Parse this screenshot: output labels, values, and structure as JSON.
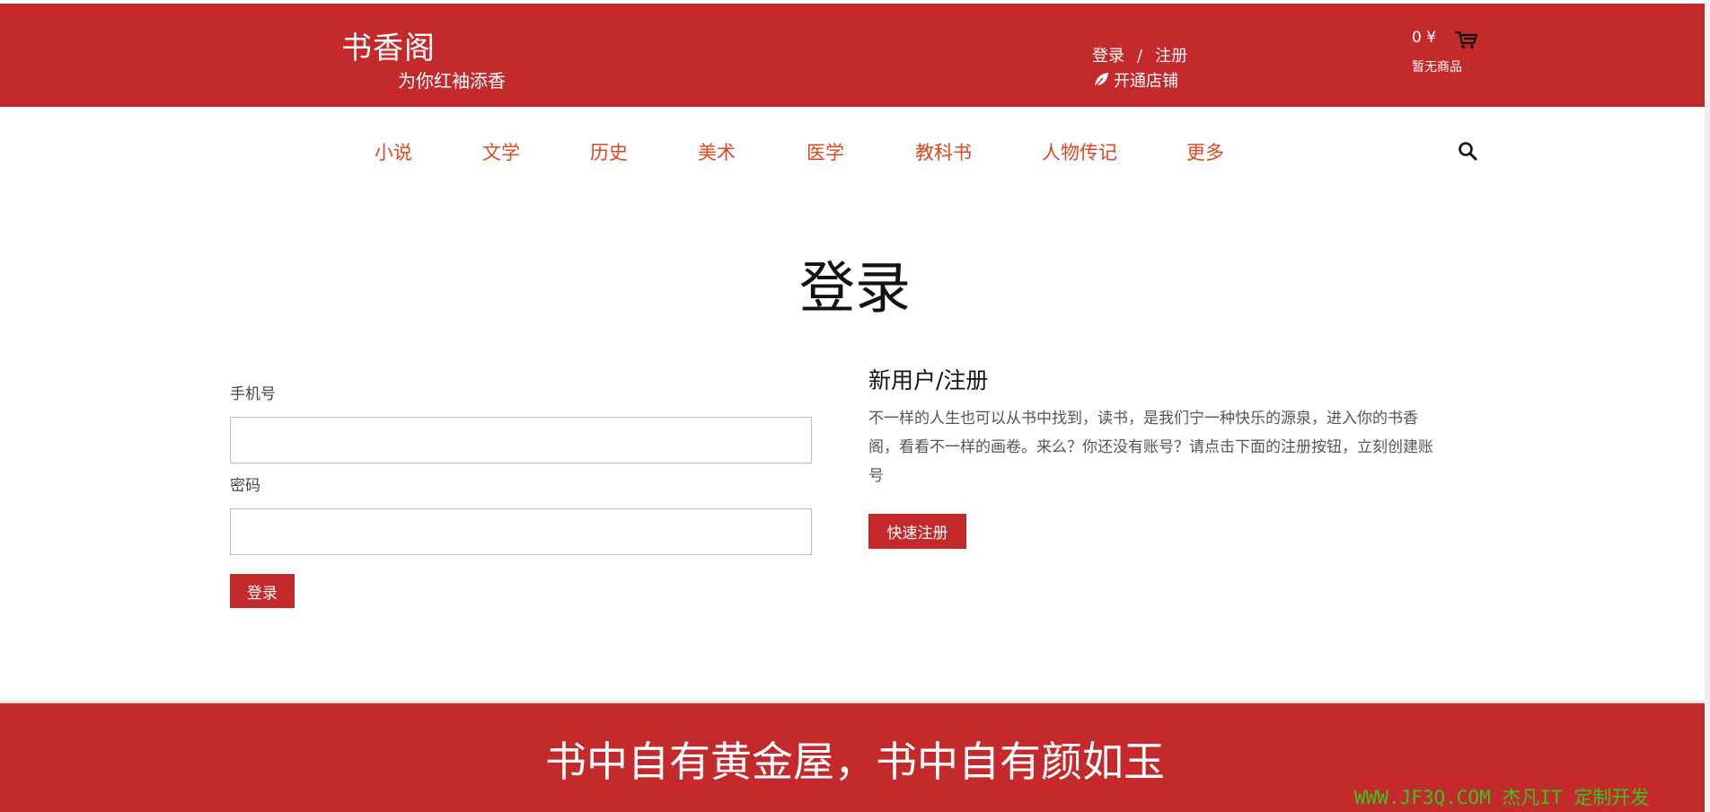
{
  "header": {
    "logo_title": "书香阁",
    "logo_subtitle": "为你红袖添香",
    "login_link": "登录",
    "separator": "/",
    "register_link": "注册",
    "open_shop_label": "开通店铺",
    "cart_amount": "0 ¥",
    "cart_status": "暂无商品"
  },
  "nav": {
    "items": [
      {
        "label": "小说"
      },
      {
        "label": "文学"
      },
      {
        "label": "历史"
      },
      {
        "label": "美术"
      },
      {
        "label": "医学"
      },
      {
        "label": "教科书"
      },
      {
        "label": "人物传记"
      },
      {
        "label": "更多"
      }
    ]
  },
  "main": {
    "title": "登录",
    "login_form": {
      "phone_label": "手机号",
      "phone_value": "",
      "password_label": "密码",
      "password_value": "",
      "submit_label": "登录"
    },
    "register_panel": {
      "title": "新用户/注册",
      "description": "不一样的人生也可以从书中找到，读书，是我们宁一种快乐的源泉，进入你的书香阁，看看不一样的画卷。来么？你还没有账号？请点击下面的注册按钮，立刻创建账号",
      "button_label": "快速注册"
    }
  },
  "footer": {
    "slogan": "书中自有黄金屋，书中自有颜如玉",
    "watermark": "WWW.JF3Q.COM 杰凡IT  定制开发"
  },
  "colors": {
    "brand_red": "#c4292b",
    "nav_orange": "#e0461f",
    "watermark_green": "#35c81e"
  }
}
